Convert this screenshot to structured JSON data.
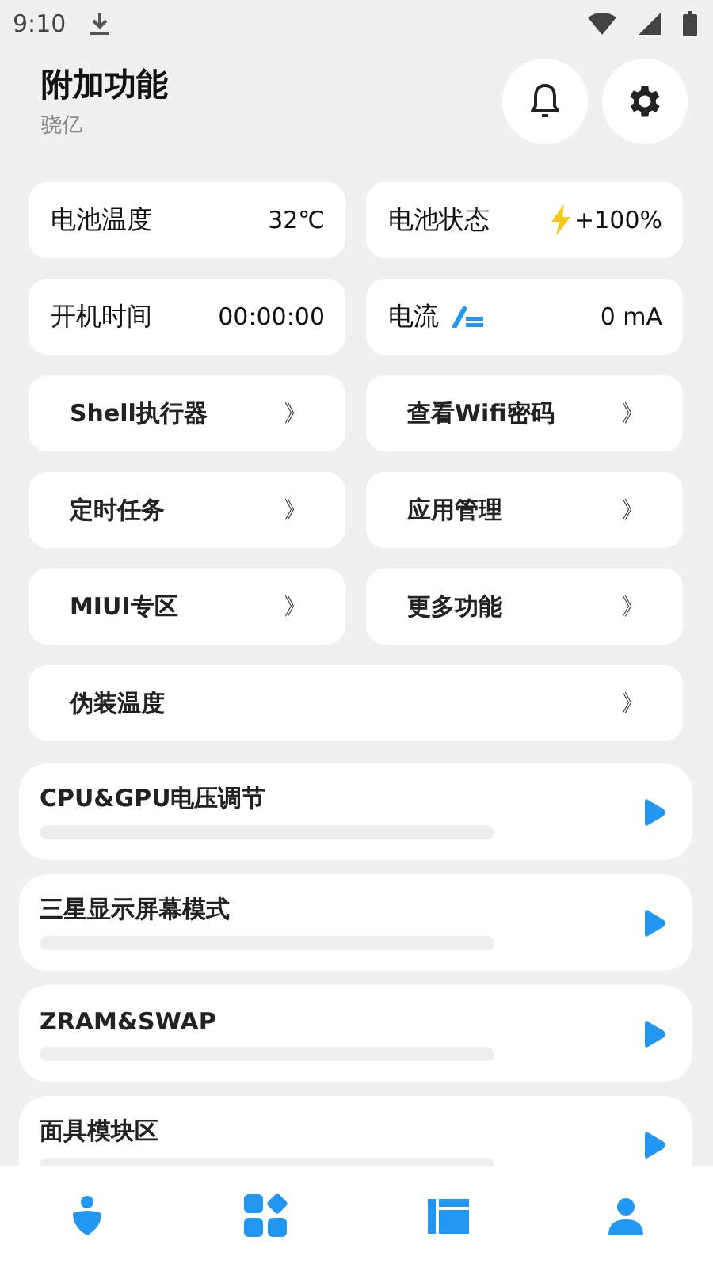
{
  "status_bar": {
    "time": "9:10"
  },
  "header": {
    "title": "附加功能",
    "subtitle": "骁亿"
  },
  "info_cards": [
    {
      "label": "电池温度",
      "value": "32℃",
      "kind": "plain"
    },
    {
      "label": "电池状态",
      "value": "+100%",
      "kind": "charging"
    },
    {
      "label": "开机时间",
      "value": "00:00:00",
      "kind": "plain"
    },
    {
      "label": "电流",
      "value": "0 mA",
      "kind": "current"
    }
  ],
  "shortcuts": [
    {
      "label": "Shell执行器",
      "arrow": "》"
    },
    {
      "label": "查看Wifi密码",
      "arrow": "》"
    },
    {
      "label": "定时任务",
      "arrow": "》"
    },
    {
      "label": "应用管理",
      "arrow": "》"
    },
    {
      "label": "MIUI专区",
      "arrow": "》"
    },
    {
      "label": "更多功能",
      "arrow": "》"
    },
    {
      "label": "伪装温度",
      "arrow": "》",
      "wide": true
    }
  ],
  "modules": [
    {
      "title": "CPU&GPU电压调节"
    },
    {
      "title": "三星显示屏幕模式"
    },
    {
      "title": "ZRAM&SWAP"
    },
    {
      "title": "面具模块区"
    }
  ]
}
